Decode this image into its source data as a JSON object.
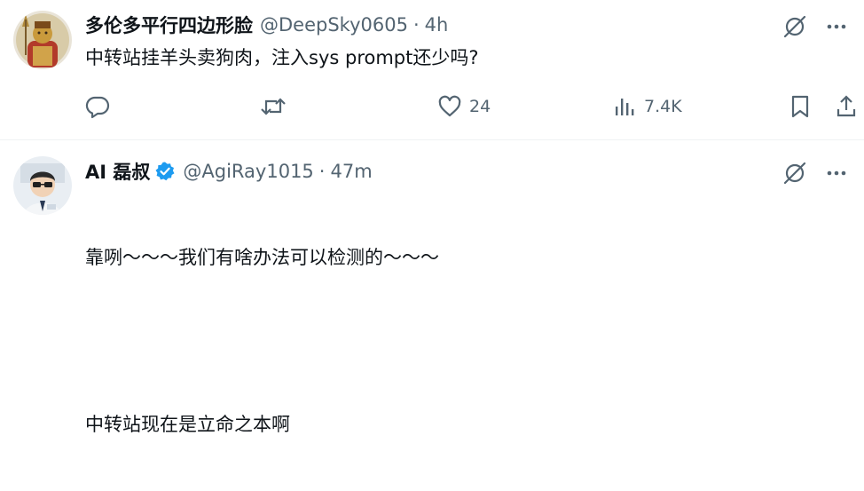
{
  "tweets": [
    {
      "name": "多伦多平行四边形脸",
      "handle": "@DeepSky0605",
      "separator": "·",
      "time": "4h",
      "text": "中转站挂羊头卖狗肉，注入sys prompt还少吗?",
      "actions": {
        "reply_count": "",
        "retweet_count": "",
        "like_count": "24",
        "view_count": "7.4K"
      },
      "icons": [
        "grok-icon",
        "more-icon",
        "reply-icon",
        "retweet-icon",
        "like-icon",
        "views-icon",
        "bookmark-icon",
        "share-icon"
      ]
    },
    {
      "name": "AI 磊叔",
      "verified": true,
      "handle": "@AgiRay1015",
      "separator": "·",
      "time": "47m",
      "text_line1": "靠咧～～～我们有啥办法可以检测的～～～",
      "text_line2": "中转站现在是立命之本啊",
      "icons": [
        "grok-icon",
        "more-icon"
      ]
    }
  ],
  "colors": {
    "text_primary": "#0f1419",
    "text_secondary": "#536471",
    "verified_blue": "#1d9bf0",
    "divider": "#eff3f4"
  }
}
